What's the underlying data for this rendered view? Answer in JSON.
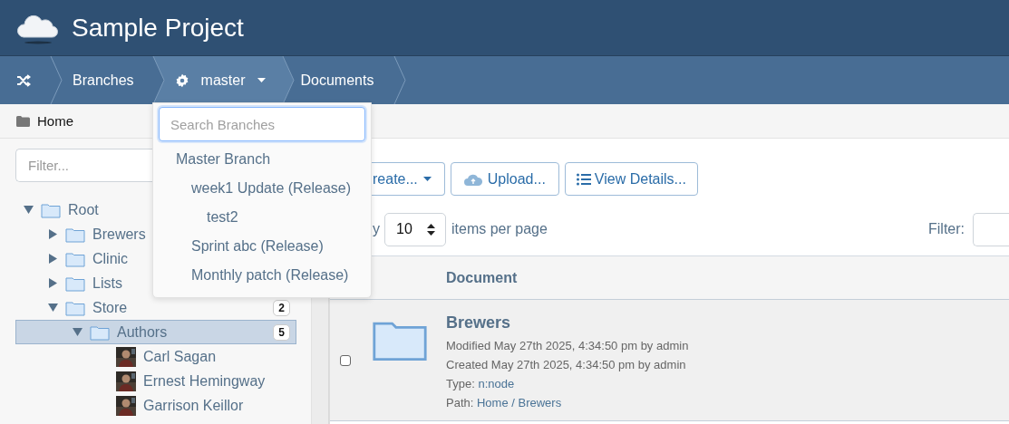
{
  "app": {
    "title": "Sample Project"
  },
  "breadcrumbs": [
    {
      "kind": "icon",
      "selected": false
    },
    {
      "kind": "text",
      "label": "Branches",
      "selected": false
    },
    {
      "kind": "branch",
      "label": "master",
      "selected": true
    },
    {
      "kind": "text",
      "label": "Documents",
      "selected": false
    }
  ],
  "location": {
    "label": "Home"
  },
  "tree": {
    "filter_placeholder": "Filter...",
    "nodes": [
      {
        "kind": "folder",
        "label": "Root",
        "expanded": true,
        "selected": false,
        "children": [
          {
            "kind": "folder",
            "label": "Brewers",
            "expanded": false,
            "selected": false
          },
          {
            "kind": "folder",
            "label": "Clinic",
            "expanded": false,
            "selected": false
          },
          {
            "kind": "folder",
            "label": "Lists",
            "expanded": false,
            "selected": false
          },
          {
            "kind": "folder",
            "label": "Store",
            "expanded": true,
            "selected": false,
            "count": "2",
            "children": [
              {
                "kind": "folder",
                "label": "Authors",
                "expanded": true,
                "selected": true,
                "count": "5",
                "children": [
                  {
                    "kind": "person",
                    "label": "Carl Sagan",
                    "selected": false
                  },
                  {
                    "kind": "person",
                    "label": "Ernest Hemingway",
                    "selected": false
                  },
                  {
                    "kind": "person",
                    "label": "Garrison Keillor",
                    "selected": false
                  }
                ]
              }
            ]
          }
        ]
      }
    ]
  },
  "branch_menu": {
    "search_placeholder": "Search Branches",
    "items": [
      {
        "label": "Master Branch",
        "children": [
          {
            "label": "week1 Update (Release)",
            "children": [
              {
                "label": "test2"
              }
            ]
          },
          {
            "label": "Sprint abc (Release)"
          },
          {
            "label": "Monthly patch (Release)"
          }
        ]
      }
    ]
  },
  "toolbar": {
    "buttons": [
      {
        "kind": "create",
        "label": "reate..."
      },
      {
        "kind": "upload",
        "label": "Upload..."
      },
      {
        "kind": "details",
        "label": "View Details..."
      }
    ]
  },
  "paging": {
    "prefix": "y",
    "page_size": "10",
    "suffix": "items per page",
    "filter_label": "Filter:"
  },
  "table": {
    "columns": [
      {
        "label": "Document"
      }
    ],
    "rows": [
      {
        "kind": "folder",
        "checked": false,
        "title": "Brewers",
        "lines": [
          {
            "text": "Modified May 27th 2025, 4:34:50 pm by admin"
          },
          {
            "text": "Created May 27th 2025, 4:34:50 pm by admin"
          },
          {
            "label": "Type:",
            "link": "n:node"
          },
          {
            "label": "Path:",
            "link": "Home / Brewers"
          }
        ]
      }
    ]
  }
}
